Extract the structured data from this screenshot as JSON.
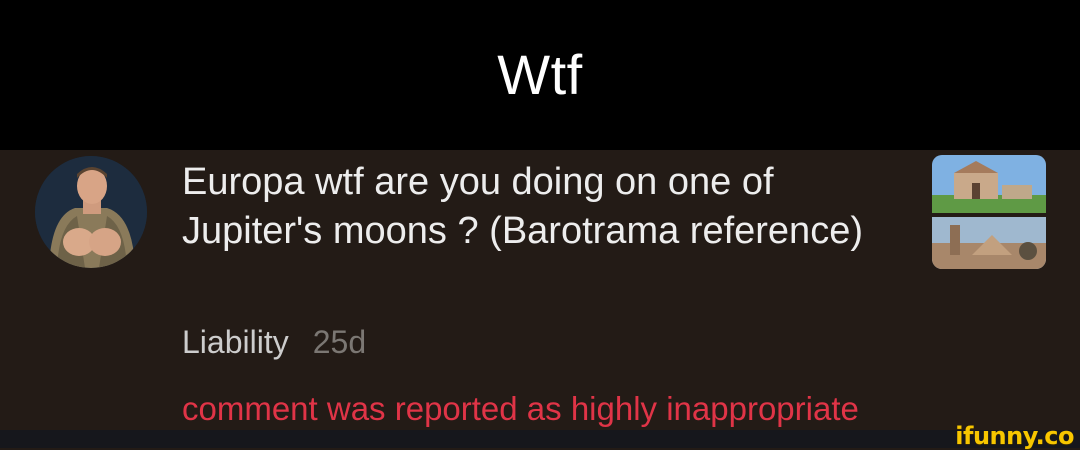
{
  "caption": {
    "text": "Wtf"
  },
  "comment": {
    "text": "Europa wtf are you doing on one of Jupiter's moons ? (Barotrama reference)",
    "author": "Liability",
    "age": "25d",
    "report_notice": "comment was reported as highly inappropriate"
  },
  "icons": {
    "avatar": "user-avatar",
    "thumbnail": "post-thumbnail"
  },
  "watermark": {
    "text": "ifunny.co"
  },
  "colors": {
    "caption_bg": "#000000",
    "comment_bg": "#231b16",
    "report_text": "#e03447",
    "watermark": "#f7c600"
  }
}
